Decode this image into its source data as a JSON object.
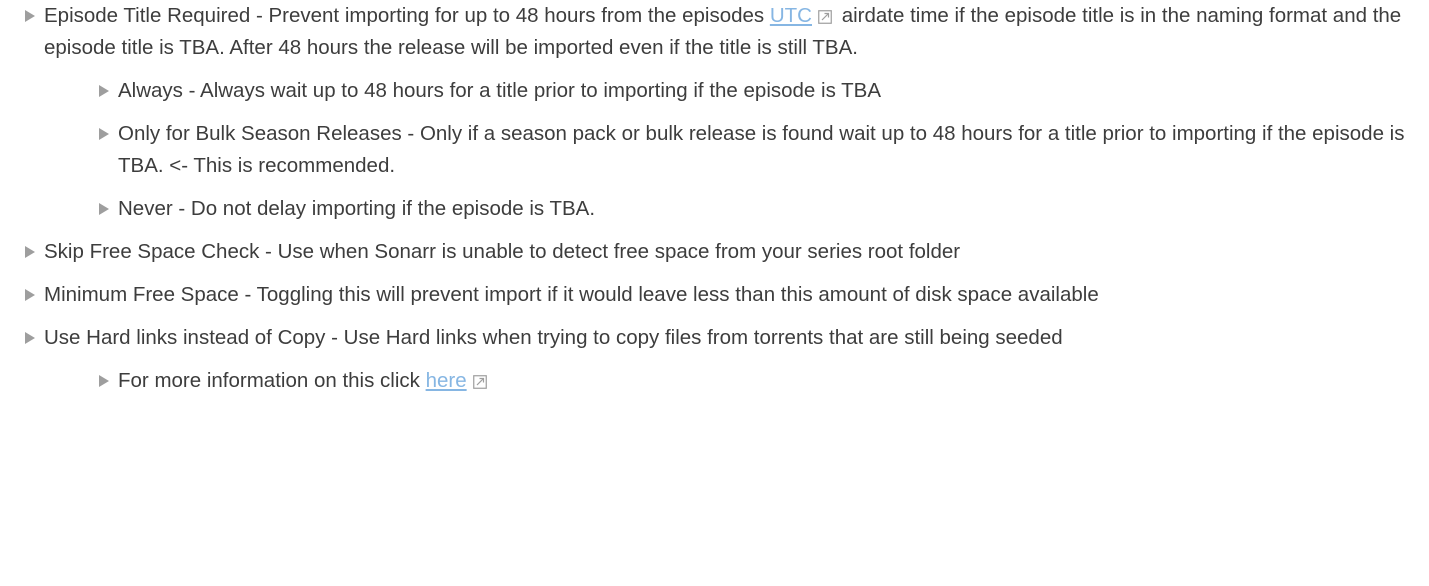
{
  "items": [
    {
      "before_link": "Episode Title Required - Prevent importing for up to 48 hours from the episodes ",
      "link_text": "UTC",
      "after_link": " airdate time if the episode title is in the naming format and the episode title is TBA. After 48 hours the release will be imported even if the title is still TBA.",
      "sub": [
        "Always - Always wait up to 48 hours for a title prior to importing if the episode is TBA",
        "Only for Bulk Season Releases - Only if a season pack or bulk release is found wait up to 48 hours for a title prior to importing if the episode is TBA. <- This is recommended.",
        "Never - Do not delay importing if the episode is TBA."
      ]
    },
    {
      "text": "Skip Free Space Check - Use when Sonarr is unable to detect free space from your series root folder"
    },
    {
      "text": "Minimum Free Space - Toggling this will prevent import if it would leave less than this amount of disk space available"
    },
    {
      "text": "Use Hard links instead of Copy - Use Hard links when trying to copy files from torrents that are still being seeded",
      "sub_before_link": "For more information on this click ",
      "sub_link_text": "here"
    }
  ],
  "colors": {
    "text": "#3d3d3d",
    "bullet": "#9e9e9e",
    "link": "#86b6e3",
    "background": "#ffffff"
  },
  "icons": {
    "bullet": "triangle-right-icon",
    "external": "external-link-icon"
  }
}
